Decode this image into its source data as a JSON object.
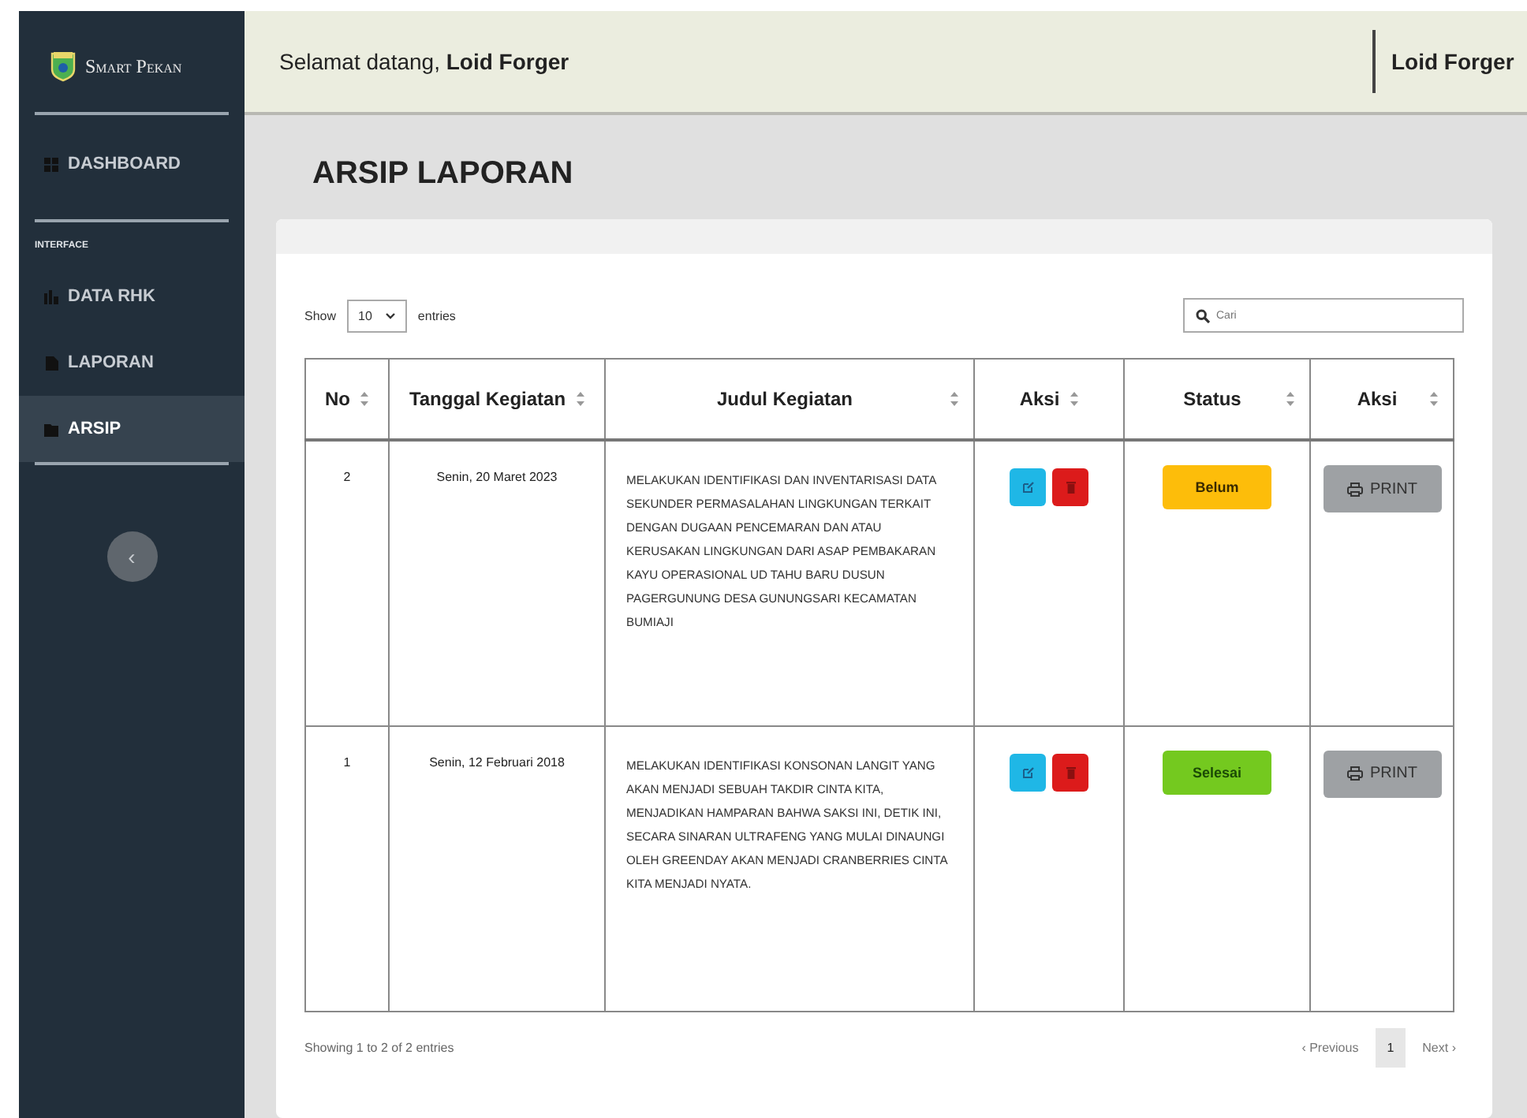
{
  "sidebar": {
    "brand": "Smart Pekan",
    "items": [
      {
        "label": "DASHBOARD",
        "selected": false,
        "kind": "link"
      },
      {
        "label": "INTERFACE",
        "kind": "heading"
      },
      {
        "label": "DATA RHK",
        "selected": false,
        "kind": "link"
      },
      {
        "label": "LAPORAN",
        "selected": false,
        "kind": "link"
      },
      {
        "label": "ARSIP",
        "selected": true,
        "kind": "link"
      }
    ],
    "toggle": "‹"
  },
  "topbar": {
    "welcome": "Selamat datang, **Loid Forger**",
    "user": "Loid Forger"
  },
  "page_title": "ARSIP LAPORAN",
  "length_menu": {
    "show": "Show",
    "value": "10",
    "entries": "entries"
  },
  "search": {
    "placeholder": "Cari"
  },
  "table": {
    "columns": [
      "No",
      "Tanggal Kegiatan",
      "Judul Kegiatan",
      "Aksi",
      "Status",
      "Aksi"
    ],
    "rows": [
      {
        "no": "2",
        "date": "Senin, 20 Maret 2023",
        "title": "MELAKUKAN IDENTIFIKASI DAN INVENTARISASI DATA SEKUNDER PERMASALAHAN LINGKUNGAN TERKAIT DENGAN DUGAAN PENCEMARAN DAN ATAU KERUSAKAN LINGKUNGAN DARI ASAP PEMBAKARAN KAYU OPERASIONAL UD TAHU BARU DUSUN PAGERGUNUNG DESA GUNUNGSARI KECAMATAN BUMIAJI",
        "status": {
          "label": "Belum",
          "kind": "pending"
        },
        "print": "PRINT"
      },
      {
        "no": "1",
        "date": "Senin, 12 Februari 2018",
        "title": "MELAKUKAN IDENTIFIKASI KONSONAN LANGIT YANG AKAN MENJADI SEBUAH TAKDIR CINTA KITA, MENJADIKAN HAMPARAN BAHWA SAKSI INI, DETIK INI, SECARA SINARAN ULTRAFENG YANG MULAI DINAUNGI OLEH GREENDAY AKAN MENJADI CRANBERRIES CINTA KITA MENJADI NYATA.",
        "status": {
          "label": "Selesai",
          "kind": "done"
        },
        "print": "PRINT"
      }
    ]
  },
  "info": "Showing 1 to 2 of 2 entries",
  "pagination": [
    {
      "label": "‹ Previous",
      "selected": false
    },
    {
      "label": "1",
      "selected": true
    },
    {
      "label": "Next ›",
      "selected": false
    }
  ]
}
